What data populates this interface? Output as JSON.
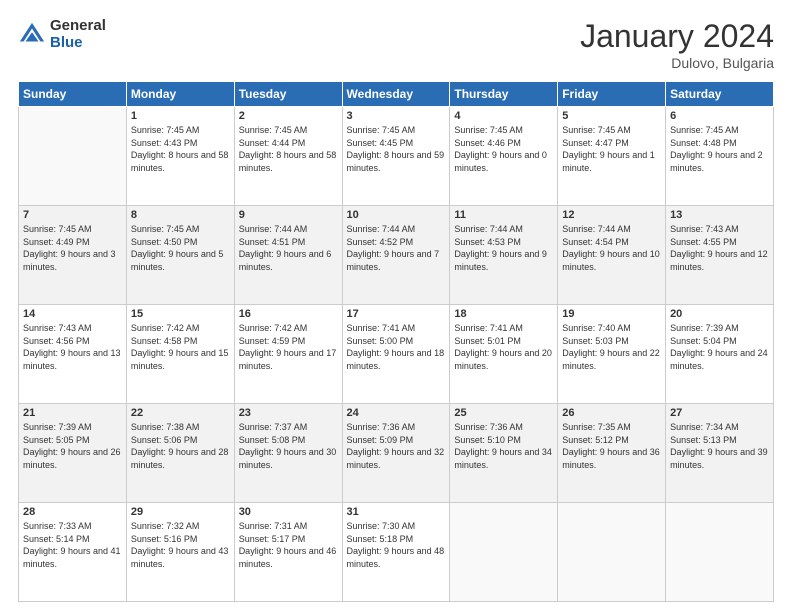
{
  "header": {
    "logo_general": "General",
    "logo_blue": "Blue",
    "month_title": "January 2024",
    "location": "Dulovo, Bulgaria"
  },
  "days_of_week": [
    "Sunday",
    "Monday",
    "Tuesday",
    "Wednesday",
    "Thursday",
    "Friday",
    "Saturday"
  ],
  "weeks": [
    [
      {
        "day": "",
        "sunrise": "",
        "sunset": "",
        "daylight": ""
      },
      {
        "day": "1",
        "sunrise": "Sunrise: 7:45 AM",
        "sunset": "Sunset: 4:43 PM",
        "daylight": "Daylight: 8 hours and 58 minutes."
      },
      {
        "day": "2",
        "sunrise": "Sunrise: 7:45 AM",
        "sunset": "Sunset: 4:44 PM",
        "daylight": "Daylight: 8 hours and 58 minutes."
      },
      {
        "day": "3",
        "sunrise": "Sunrise: 7:45 AM",
        "sunset": "Sunset: 4:45 PM",
        "daylight": "Daylight: 8 hours and 59 minutes."
      },
      {
        "day": "4",
        "sunrise": "Sunrise: 7:45 AM",
        "sunset": "Sunset: 4:46 PM",
        "daylight": "Daylight: 9 hours and 0 minutes."
      },
      {
        "day": "5",
        "sunrise": "Sunrise: 7:45 AM",
        "sunset": "Sunset: 4:47 PM",
        "daylight": "Daylight: 9 hours and 1 minute."
      },
      {
        "day": "6",
        "sunrise": "Sunrise: 7:45 AM",
        "sunset": "Sunset: 4:48 PM",
        "daylight": "Daylight: 9 hours and 2 minutes."
      }
    ],
    [
      {
        "day": "7",
        "sunrise": "Sunrise: 7:45 AM",
        "sunset": "Sunset: 4:49 PM",
        "daylight": "Daylight: 9 hours and 3 minutes."
      },
      {
        "day": "8",
        "sunrise": "Sunrise: 7:45 AM",
        "sunset": "Sunset: 4:50 PM",
        "daylight": "Daylight: 9 hours and 5 minutes."
      },
      {
        "day": "9",
        "sunrise": "Sunrise: 7:44 AM",
        "sunset": "Sunset: 4:51 PM",
        "daylight": "Daylight: 9 hours and 6 minutes."
      },
      {
        "day": "10",
        "sunrise": "Sunrise: 7:44 AM",
        "sunset": "Sunset: 4:52 PM",
        "daylight": "Daylight: 9 hours and 7 minutes."
      },
      {
        "day": "11",
        "sunrise": "Sunrise: 7:44 AM",
        "sunset": "Sunset: 4:53 PM",
        "daylight": "Daylight: 9 hours and 9 minutes."
      },
      {
        "day": "12",
        "sunrise": "Sunrise: 7:44 AM",
        "sunset": "Sunset: 4:54 PM",
        "daylight": "Daylight: 9 hours and 10 minutes."
      },
      {
        "day": "13",
        "sunrise": "Sunrise: 7:43 AM",
        "sunset": "Sunset: 4:55 PM",
        "daylight": "Daylight: 9 hours and 12 minutes."
      }
    ],
    [
      {
        "day": "14",
        "sunrise": "Sunrise: 7:43 AM",
        "sunset": "Sunset: 4:56 PM",
        "daylight": "Daylight: 9 hours and 13 minutes."
      },
      {
        "day": "15",
        "sunrise": "Sunrise: 7:42 AM",
        "sunset": "Sunset: 4:58 PM",
        "daylight": "Daylight: 9 hours and 15 minutes."
      },
      {
        "day": "16",
        "sunrise": "Sunrise: 7:42 AM",
        "sunset": "Sunset: 4:59 PM",
        "daylight": "Daylight: 9 hours and 17 minutes."
      },
      {
        "day": "17",
        "sunrise": "Sunrise: 7:41 AM",
        "sunset": "Sunset: 5:00 PM",
        "daylight": "Daylight: 9 hours and 18 minutes."
      },
      {
        "day": "18",
        "sunrise": "Sunrise: 7:41 AM",
        "sunset": "Sunset: 5:01 PM",
        "daylight": "Daylight: 9 hours and 20 minutes."
      },
      {
        "day": "19",
        "sunrise": "Sunrise: 7:40 AM",
        "sunset": "Sunset: 5:03 PM",
        "daylight": "Daylight: 9 hours and 22 minutes."
      },
      {
        "day": "20",
        "sunrise": "Sunrise: 7:39 AM",
        "sunset": "Sunset: 5:04 PM",
        "daylight": "Daylight: 9 hours and 24 minutes."
      }
    ],
    [
      {
        "day": "21",
        "sunrise": "Sunrise: 7:39 AM",
        "sunset": "Sunset: 5:05 PM",
        "daylight": "Daylight: 9 hours and 26 minutes."
      },
      {
        "day": "22",
        "sunrise": "Sunrise: 7:38 AM",
        "sunset": "Sunset: 5:06 PM",
        "daylight": "Daylight: 9 hours and 28 minutes."
      },
      {
        "day": "23",
        "sunrise": "Sunrise: 7:37 AM",
        "sunset": "Sunset: 5:08 PM",
        "daylight": "Daylight: 9 hours and 30 minutes."
      },
      {
        "day": "24",
        "sunrise": "Sunrise: 7:36 AM",
        "sunset": "Sunset: 5:09 PM",
        "daylight": "Daylight: 9 hours and 32 minutes."
      },
      {
        "day": "25",
        "sunrise": "Sunrise: 7:36 AM",
        "sunset": "Sunset: 5:10 PM",
        "daylight": "Daylight: 9 hours and 34 minutes."
      },
      {
        "day": "26",
        "sunrise": "Sunrise: 7:35 AM",
        "sunset": "Sunset: 5:12 PM",
        "daylight": "Daylight: 9 hours and 36 minutes."
      },
      {
        "day": "27",
        "sunrise": "Sunrise: 7:34 AM",
        "sunset": "Sunset: 5:13 PM",
        "daylight": "Daylight: 9 hours and 39 minutes."
      }
    ],
    [
      {
        "day": "28",
        "sunrise": "Sunrise: 7:33 AM",
        "sunset": "Sunset: 5:14 PM",
        "daylight": "Daylight: 9 hours and 41 minutes."
      },
      {
        "day": "29",
        "sunrise": "Sunrise: 7:32 AM",
        "sunset": "Sunset: 5:16 PM",
        "daylight": "Daylight: 9 hours and 43 minutes."
      },
      {
        "day": "30",
        "sunrise": "Sunrise: 7:31 AM",
        "sunset": "Sunset: 5:17 PM",
        "daylight": "Daylight: 9 hours and 46 minutes."
      },
      {
        "day": "31",
        "sunrise": "Sunrise: 7:30 AM",
        "sunset": "Sunset: 5:18 PM",
        "daylight": "Daylight: 9 hours and 48 minutes."
      },
      {
        "day": "",
        "sunrise": "",
        "sunset": "",
        "daylight": ""
      },
      {
        "day": "",
        "sunrise": "",
        "sunset": "",
        "daylight": ""
      },
      {
        "day": "",
        "sunrise": "",
        "sunset": "",
        "daylight": ""
      }
    ]
  ]
}
